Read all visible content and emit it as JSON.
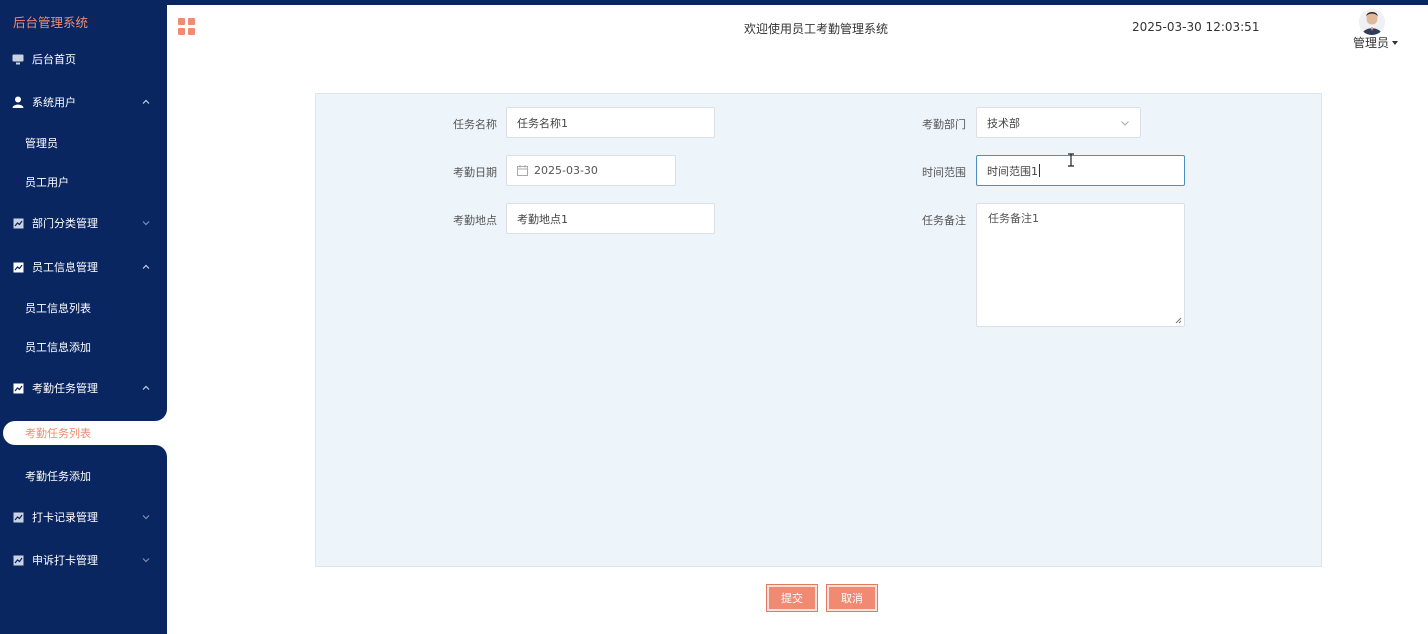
{
  "app": {
    "title": "后台管理系统"
  },
  "header": {
    "welcome": "欢迎使用员工考勤管理系统",
    "datetime": "2025-03-30 12:03:51",
    "user": "管理员"
  },
  "sidebar": {
    "items": [
      {
        "label": "后台首页",
        "icon": "monitor-icon"
      },
      {
        "label": "系统用户",
        "icon": "user-icon",
        "expanded": true
      },
      {
        "label": "管理员"
      },
      {
        "label": "员工用户"
      },
      {
        "label": "部门分类管理",
        "icon": "chart-icon",
        "expanded": false
      },
      {
        "label": "员工信息管理",
        "icon": "chart-icon",
        "expanded": true
      },
      {
        "label": "员工信息列表"
      },
      {
        "label": "员工信息添加"
      },
      {
        "label": "考勤任务管理",
        "icon": "chart-icon",
        "expanded": true
      },
      {
        "label": "考勤任务列表",
        "active": true
      },
      {
        "label": "考勤任务添加"
      },
      {
        "label": "打卡记录管理",
        "icon": "chart-icon",
        "expanded": false
      },
      {
        "label": "申诉打卡管理",
        "icon": "chart-icon",
        "expanded": false
      }
    ]
  },
  "form": {
    "task_name": {
      "label": "任务名称",
      "value": "任务名称1"
    },
    "department": {
      "label": "考勤部门",
      "value": "技术部"
    },
    "date": {
      "label": "考勤日期",
      "value": "2025-03-30"
    },
    "time_range": {
      "label": "时间范围",
      "value": "时间范围1"
    },
    "location": {
      "label": "考勤地点",
      "value": "考勤地点1"
    },
    "remark": {
      "label": "任务备注",
      "value": "任务备注1"
    }
  },
  "buttons": {
    "submit": "提交",
    "cancel": "取消"
  },
  "colors": {
    "sidebar_bg": "#0a2660",
    "accent": "#f18a73",
    "panel_bg": "#eef5fa",
    "focus_border": "#4a90c2"
  }
}
